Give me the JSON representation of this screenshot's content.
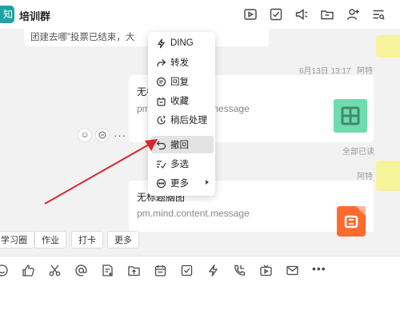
{
  "header": {
    "avatar_char": "知",
    "title": "培训群",
    "icons": [
      "video-icon",
      "task-check-icon",
      "announcement-icon",
      "folder-icon",
      "add-member-icon",
      "settings-menu-icon"
    ]
  },
  "messages": {
    "previous_text": "团建去哪”投票已结束，大",
    "first": {
      "date": "6月13日 13:17",
      "sender": "阿特",
      "title": "无标",
      "subtitle": "pm.mind.content.message",
      "read_status": "全部已读"
    },
    "second": {
      "sender": "阿特",
      "title": "无标题脑图",
      "subtitle": "pm.mind.content.message"
    }
  },
  "context_menu": {
    "items": [
      {
        "label": "DING",
        "icon": "ding-icon"
      },
      {
        "label": "转发",
        "icon": "forward-icon"
      },
      {
        "label": "回复",
        "icon": "reply-icon"
      },
      {
        "label": "收藏",
        "icon": "favorite-icon"
      },
      {
        "label": "稍后处理",
        "icon": "later-icon"
      },
      {
        "label": "撤回",
        "icon": "recall-icon",
        "highlighted": true
      },
      {
        "label": "多选",
        "icon": "multi-select-icon"
      },
      {
        "label": "更多",
        "icon": "more-circle-icon",
        "has_submenu": true
      }
    ]
  },
  "quick_tags": [
    "学习圈",
    "作业",
    "打卡",
    "更多"
  ],
  "toolbar": {
    "icons": [
      "emoji-icon",
      "thumbs-up-icon",
      "scissors-icon",
      "mention-icon",
      "doc-icon",
      "upload-icon",
      "calendar-icon",
      "task-icon",
      "ding-icon",
      "phone-icon",
      "live-icon",
      "mail-icon",
      "more-icon"
    ],
    "more_glyph": "•••"
  },
  "colors": {
    "accent": "#1fa2a3",
    "annotation_arrow": "#d9262b",
    "menu_highlight": "#e3e3e3"
  }
}
